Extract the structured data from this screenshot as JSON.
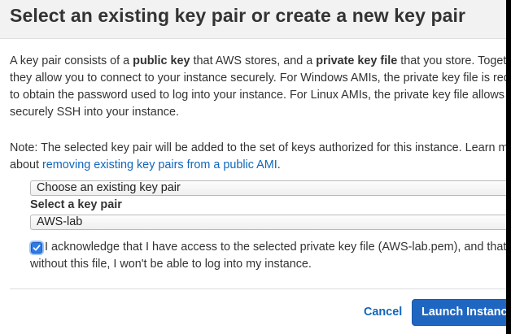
{
  "dialog": {
    "title": "Select an existing key pair or create a new key pair",
    "intro": {
      "l1_a": "A key pair consists of a ",
      "l1_b": "public key",
      "l1_c": " that AWS stores, and a ",
      "l1_d": "private key file",
      "l1_e": " that you store. Togethe",
      "l2": "they allow you to connect to your instance securely. For Windows AMIs, the private key file is requ",
      "l3": "to obtain the password used to log into your instance. For Linux AMIs, the private key file allows y",
      "l4": "securely SSH into your instance."
    },
    "note": {
      "l1": "Note: The selected key pair will be added to the set of keys authorized for this instance. Learn mo",
      "l2_a": "about ",
      "link": "removing existing key pairs from a public AMI",
      "l2_b": "."
    },
    "mode_select": {
      "value": "Choose an existing key pair"
    },
    "key_pair": {
      "label": "Select a key pair",
      "value": "AWS-lab"
    },
    "acknowledge": {
      "checked": true,
      "l1": "I acknowledge that I have access to the selected private key file (AWS-lab.pem), and that",
      "l2": "without this file, I won't be able to log into my instance."
    },
    "buttons": {
      "cancel": "Cancel",
      "launch": "Launch Instance"
    },
    "colors": {
      "link": "#1166bb",
      "primary": "#1f66c1",
      "header_bg": "#f2f2f2"
    }
  }
}
